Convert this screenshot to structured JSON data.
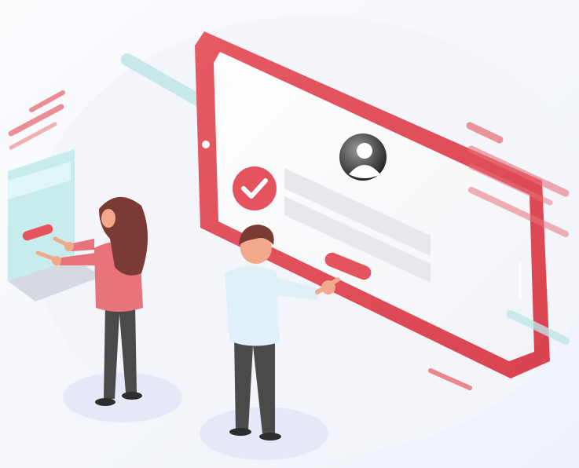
{
  "illustration": {
    "subject": "",
    "palette": {
      "accent": "#e5545e",
      "accent_light": "#f2a6ab",
      "teal": "#bfe6e6",
      "background": "#f4f6fb",
      "shadow": "#e6e8f7",
      "hair": "#7a3b34",
      "skin": "#f2a88a",
      "shirt_woman": "#e8737b",
      "shirt_man": "#dff0f8",
      "pants": "#4a4a4a"
    },
    "icons": [
      "check-icon",
      "user-avatar-icon"
    ]
  }
}
